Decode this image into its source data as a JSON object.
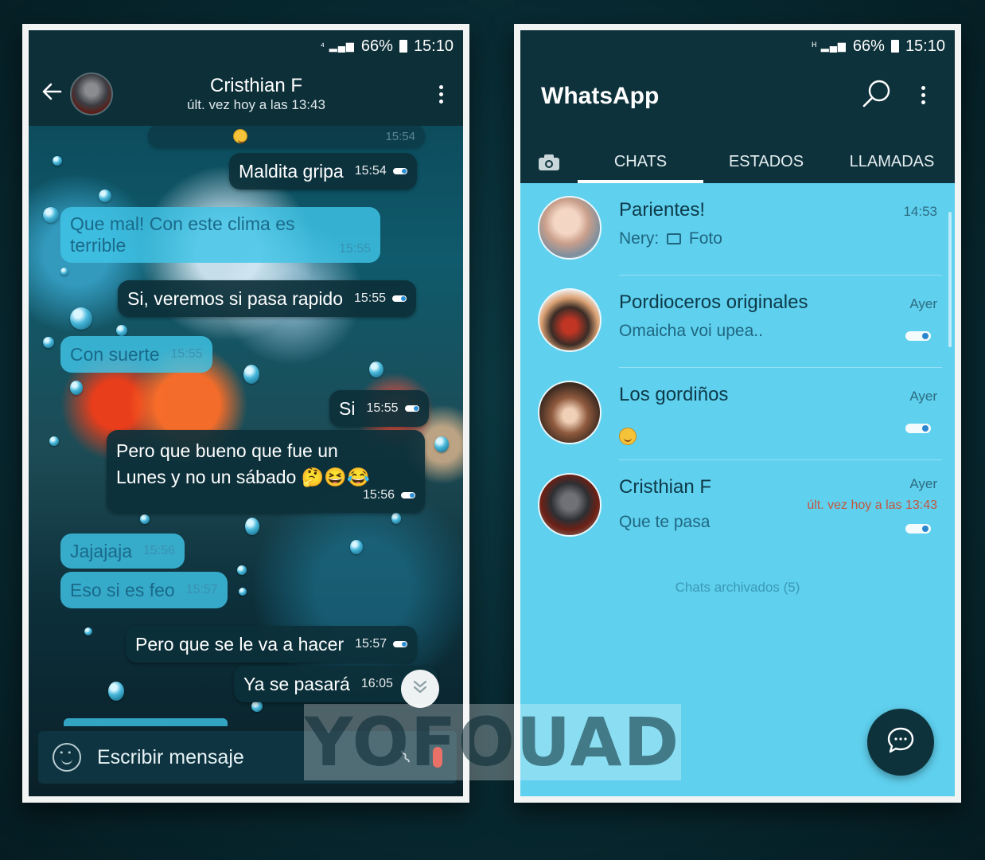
{
  "left_phone": {
    "status": {
      "battery": "66%",
      "time": "15:10"
    },
    "contact": {
      "name": "Cristhian F",
      "last_seen": "últ. vez hoy a las 13:43"
    },
    "messages": [
      {
        "text": "Maldita gripa",
        "time": "15:54",
        "dir": "out"
      },
      {
        "text": "Que mal!  Con este clima es",
        "text2": "terrible",
        "time": "15:55",
        "dir": "in"
      },
      {
        "text": "Si, veremos si pasa rapido",
        "time": "15:55",
        "dir": "out"
      },
      {
        "text": "Con suerte",
        "time": "15:55",
        "dir": "in"
      },
      {
        "text": "Si",
        "time": "15:55",
        "dir": "out"
      },
      {
        "text": "Pero que bueno que fue un",
        "text2": "Lunes y no un sábado 🤔😆😂",
        "time": "15:56",
        "dir": "out"
      },
      {
        "text": "Jajajaja",
        "time": "15:56",
        "dir": "in"
      },
      {
        "text": "Eso si es feo",
        "time": "15:57",
        "dir": "in"
      },
      {
        "text": "Pero que se le va a hacer",
        "time": "15:57",
        "dir": "out"
      },
      {
        "text": "Ya se pasará",
        "time": "16:05",
        "dir": "out"
      }
    ],
    "partial_time": "15:54",
    "composer_placeholder": "Escribir mensaje"
  },
  "right_phone": {
    "status": {
      "battery": "66%",
      "time": "15:10"
    },
    "app_title": "WhatsApp",
    "tabs": [
      "CHATS",
      "ESTADOS",
      "LLAMADAS"
    ],
    "active_tab": "CHATS",
    "chats": [
      {
        "name": "Parientes!",
        "sender": "Nery:",
        "preview": "Foto",
        "time": "14:53"
      },
      {
        "name": "Pordioceros originales",
        "preview": "Omaicha voi upea..",
        "time": "Ayer"
      },
      {
        "name": "Los gordiños",
        "preview": "😊",
        "time": "Ayer"
      },
      {
        "name": "Cristhian F",
        "sub": "últ. vez hoy a las 13:43",
        "preview": "Que te pasa",
        "time": "Ayer"
      }
    ],
    "archived_label": "Chats archivados (5)"
  },
  "watermark": "YOFOUAD",
  "colors": {
    "dark_teal": "#0e323b",
    "list_bg": "#5fd0ee",
    "incoming_bubble": "#3fc4e8",
    "outgoing_bubble": "#0c303a",
    "accent_red": "#c3573f"
  }
}
